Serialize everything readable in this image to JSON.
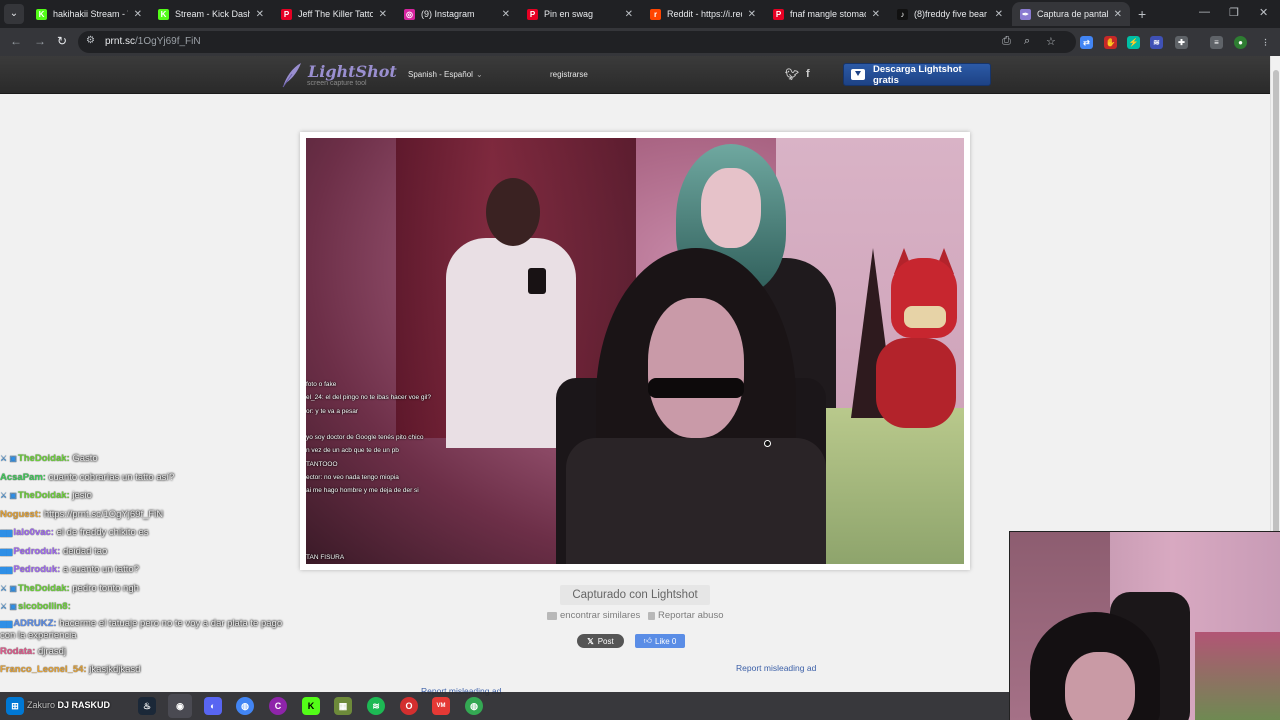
{
  "browser": {
    "tabs": [
      {
        "title": "hakihakii Stream - W",
        "fav": "K",
        "color": "#53fc18",
        "active": false
      },
      {
        "title": "Stream - Kick Dashbo",
        "fav": "K",
        "color": "#53fc18",
        "active": false
      },
      {
        "title": "Jeff The Killer Tattoo",
        "fav": "P",
        "color": "#e60023",
        "active": false
      },
      {
        "title": "(9) Instagram",
        "fav": "◎",
        "color": "#d6249f",
        "active": false
      },
      {
        "title": "Pin en swag",
        "fav": "P",
        "color": "#e60023",
        "active": false
      },
      {
        "title": "Reddit - https://i.red",
        "fav": "r",
        "color": "#ff4500",
        "active": false
      },
      {
        "title": "fnaf mangle stomach",
        "fav": "P",
        "color": "#e60023",
        "active": false
      },
      {
        "title": "(8)freddy five bear",
        "fav": "♪",
        "color": "#111111",
        "active": false
      },
      {
        "title": "Captura de pantalla",
        "fav": "✒",
        "color": "#8a7bd1",
        "active": true
      }
    ],
    "url_host": "prnt.sc",
    "url_path": "/1OgYj69f_FiN"
  },
  "lightshot": {
    "logo": "LightShot",
    "tagline": "screen capture tool",
    "language": "Spanish - Español",
    "register": "registrarse",
    "download_btn": "Descarga Lightshot gratis",
    "captured_with": "Capturado con Lightshot",
    "find_similar": "encontrar similares",
    "report_abuse": "Reportar abuso",
    "x_post": "Post",
    "fb_like": "Like 0",
    "report_ad": "Report misleading ad",
    "report_ad_2": "Report misleading ad"
  },
  "screenshot_chat": [
    "foto o fake",
    "el_24: el del pingo no te ibas hacer voe gil?",
    "or: y te va a pesar",
    "",
    "yo soy doctor de Google tenés pito chico",
    "n vez de un acb que te de un pb",
    "TANTOOO",
    "ector: no veo nada tengo miopia",
    "ai me hago hombre y me deja de der si",
    "",
    "",
    "",
    "",
    "TAN FISURA"
  ],
  "stream_chat": [
    {
      "badge": "⚔ ▣",
      "user": "TheDoidak:",
      "user_color": "#6ed13c",
      "msg": "Gasto"
    },
    {
      "badge": "",
      "user": "AcsaPam:",
      "user_color": "#41c85a",
      "msg": "cuanto cobrarías un tatto así?"
    },
    {
      "badge": "⚔ ▣",
      "user": "TheDoidak:",
      "user_color": "#6ed13c",
      "msg": "jesio"
    },
    {
      "badge": "",
      "user": "Noguest:",
      "user_color": "#e3a33a",
      "msg": "https://prnt.sc/1OgYj69f_FiN"
    },
    {
      "badge": "▆▆",
      "user": "lalo0vac:",
      "user_color": "#a06bf0",
      "msg": "el de freddy chikito es"
    },
    {
      "badge": "▆▆",
      "user": "Pedroduk:",
      "user_color": "#a06bf0",
      "msg": "deidad tao"
    },
    {
      "badge": "▆▆",
      "user": "Pedroduk:",
      "user_color": "#a06bf0",
      "msg": "a cuanto un tatto?"
    },
    {
      "badge": "⚔ ▣",
      "user": "TheDoidak:",
      "user_color": "#6ed13c",
      "msg": "pedro tonto ngh"
    },
    {
      "badge": "⚔ ▣",
      "user": "sicobollin8:",
      "user_color": "#6ed13c",
      "msg": ""
    },
    {
      "badge": "▆▆",
      "user": "ADRUKZ:",
      "user_color": "#5b8de8",
      "msg": "hacerme el tatuaje pero no te voy a dar plata te pago con la experiencia",
      "wrap": true
    },
    {
      "badge": "",
      "user": "Rodata:",
      "user_color": "#e05a8c",
      "msg": "djrasdj"
    },
    {
      "badge": "",
      "user": "Franco_Leonel_54:",
      "user_color": "#e3a33a",
      "msg": "jkasjkdjkasd"
    }
  ],
  "taskbar": {
    "stream_label_prefix": "Zakuro",
    "stream_label": "DJ RASKUD"
  }
}
